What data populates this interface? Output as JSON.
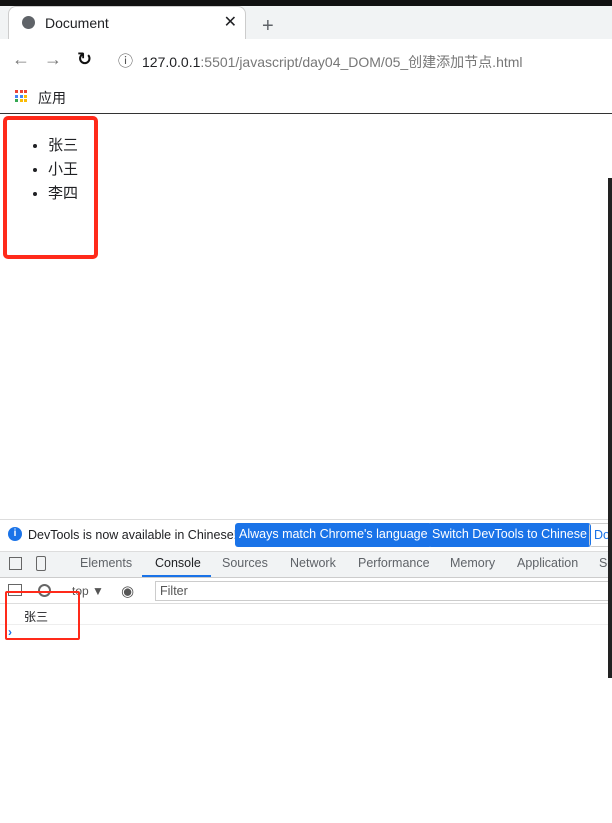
{
  "browser": {
    "tab_title": "Document",
    "url_host": "127.0.0.1",
    "url_rest": ":5501/javascript/day04_DOM/05_创建添加节点.html",
    "bookmark_apps": "应用",
    "new_tab": "+",
    "close": "✕",
    "back": "←",
    "forward": "→",
    "reload": "↻",
    "info": "ⓘ"
  },
  "page": {
    "list_items": [
      "张三",
      "小王",
      "李四"
    ]
  },
  "devtools": {
    "info_text": "DevTools is now available in Chinese!",
    "btn_match": "Always match Chrome's language",
    "btn_switch": "Switch DevTools to Chinese",
    "btn_dont": "Don't show again",
    "tabs": [
      "Elements",
      "Console",
      "Sources",
      "Network",
      "Performance",
      "Memory",
      "Application",
      "Security"
    ],
    "active_tab": "Console",
    "context": "top ▼",
    "filter_placeholder": "Filter",
    "console_output": "张三",
    "prompt": "›"
  },
  "colors": {
    "highlight_box": "#ff2a1a",
    "accent": "#1a73e8"
  }
}
